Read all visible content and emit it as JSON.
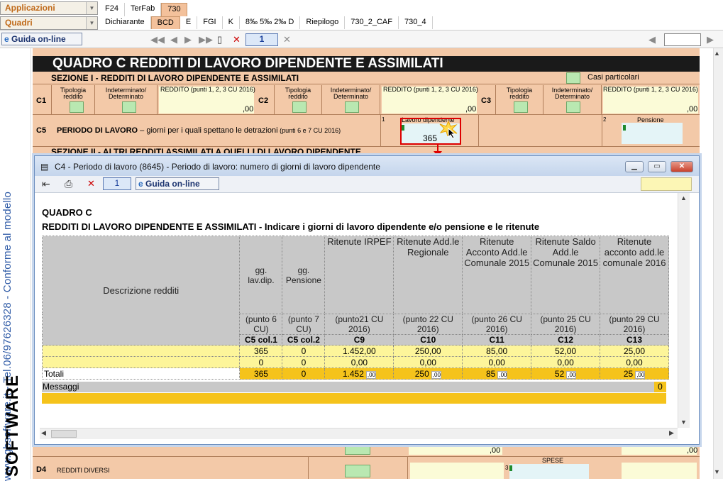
{
  "top": {
    "applicazioni": "Applicazioni",
    "quadri": "Quadri",
    "row1_tabs": [
      "F24",
      "TerFab",
      "730"
    ],
    "row2_tabs": [
      "Dichiarante",
      "BCD",
      "E",
      "FGI",
      "K",
      "8‰ 5‰ 2‰ D",
      "Riepilogo",
      "730_2_CAF",
      "730_4"
    ],
    "guida": "Guida on-line",
    "page": "1"
  },
  "side": {
    "vertical_text": "www.gbsoftware.it - Tel.06/97626328 - Conforme al modello",
    "brand": "SOFTWARE"
  },
  "form": {
    "title": "QUADRO   C   REDDITI DI LAVORO DIPENDENTE E ASSIMILATI",
    "sec1": "SEZIONE I -  REDDITI DI LAVORO DIPENDENTE E ASSIMILATI",
    "casi": "Casi particolari",
    "c1": "C1",
    "c2": "C2",
    "c3": "C3",
    "c5": "C5",
    "d4": "D4",
    "tip": "Tipologia reddito",
    "ind": "Indeterminato/ Determinato",
    "red": "REDDITO (punti 1, 2, 3 CU 2016)",
    "zero": ",00",
    "periodo": "PERIODO DI LAVORO",
    "periodo_sub": " – giorni per i quali spettano le detrazioni",
    "periodo_note": " (punti 6 e 7 CU 2016)",
    "lav_dip": "Lavoro dipendente",
    "lav_val": "365",
    "pensione": "Pensione",
    "sec2": "SEZIONE II - ALTRI REDDITI ASSIMILATI A QUELLI DI LAVORO DIPENDENTE",
    "redditi_diversi": "REDDITI DIVERSI",
    "spese": "SPESE",
    "n1": "1",
    "n2": "2",
    "n3": "3"
  },
  "dialog": {
    "title": "C4 - Periodo di lavoro (8645) - Periodo di lavoro: numero di giorni di lavoro dipendente",
    "page": "1",
    "guida": "Guida on-line",
    "heading1": "QUADRO C",
    "heading2": "REDDITI DI LAVORO DIPENDENTE E ASSIMILATI - Indicare i giorni di lavoro dipendente e/o pensione e le ritenute",
    "desc_header": "Descrizione redditi",
    "columns": [
      {
        "label": "gg. lav.dip.",
        "sub": "(punto 6 CU)",
        "code": "C5 col.1"
      },
      {
        "label": "gg. Pensione",
        "sub": "(punto 7 CU)",
        "code": "C5 col.2"
      },
      {
        "label": "Ritenute IRPEF",
        "sub": "(punto21 CU 2016)",
        "code": "C9"
      },
      {
        "label": "Ritenute Add.le Regionale",
        "sub": "(punto 22 CU 2016)",
        "code": "C10"
      },
      {
        "label": "Ritenute Acconto Add.le Comunale 2015",
        "sub": "(punto 26 CU 2016)",
        "code": "C11"
      },
      {
        "label": "Ritenute Saldo Add.le Comunale 2015",
        "sub": "(punto 25 CU 2016)",
        "code": "C12"
      },
      {
        "label": "Ritenute acconto add.le comunale 2016",
        "sub": "(punto 29 CU 2016)",
        "code": "C13"
      }
    ],
    "rows": [
      [
        "365",
        "0",
        "1.452,00",
        "250,00",
        "85,00",
        "52,00",
        "25,00"
      ],
      [
        "0",
        "0",
        "0,00",
        "0,00",
        "0,00",
        "0,00",
        "0,00"
      ]
    ],
    "totali_label": "Totali",
    "totali": [
      "365",
      "0",
      "1.452",
      "250",
      "85",
      "52",
      "25"
    ],
    "dec": ",00",
    "messaggi": "Messaggi",
    "messaggi_count": "0"
  }
}
